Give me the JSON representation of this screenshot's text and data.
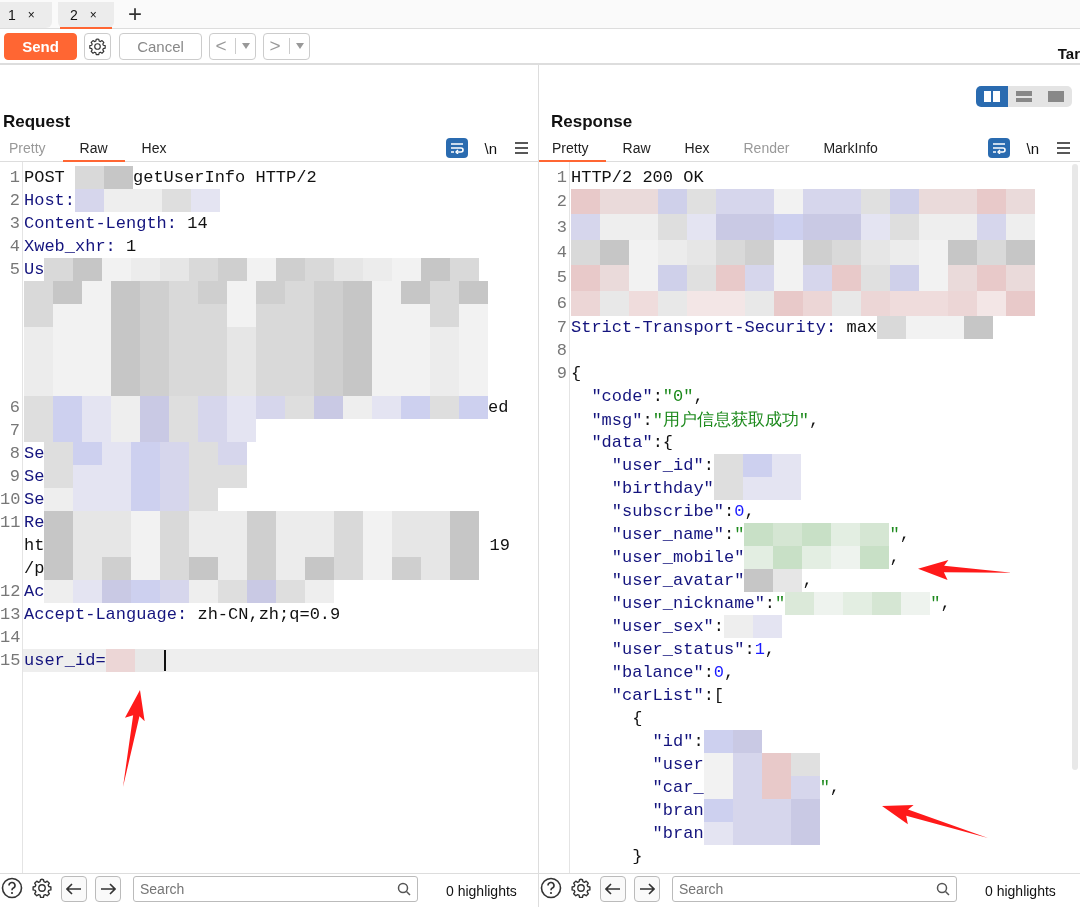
{
  "tabs": [
    {
      "label": "1",
      "close": "×",
      "selected": false
    },
    {
      "label": "2",
      "close": "×",
      "selected": true
    }
  ],
  "new_tab": "+",
  "toolbar": {
    "send": "Send",
    "cancel": "Cancel",
    "back": "<",
    "forward": ">",
    "cut_label": "Tar"
  },
  "view_buttons": [
    {
      "selected": true
    },
    {
      "selected": false
    },
    {
      "selected": false
    }
  ],
  "request": {
    "title": "Request",
    "newline": "\\n",
    "tabs": [
      {
        "label": "Pretty",
        "selected": false,
        "disabled": true
      },
      {
        "label": "Raw",
        "selected": true,
        "disabled": false
      },
      {
        "label": "Hex",
        "selected": false,
        "disabled": false
      }
    ],
    "lines": [
      {
        "number": "1",
        "current": false,
        "parts": [
          {
            "kind": "plain",
            "text": "POST "
          },
          {
            "kind": "mask"
          },
          {
            "kind": "plain",
            "text": "getUserInfo HTTP/2"
          }
        ]
      },
      {
        "number": "2",
        "current": false,
        "parts": [
          {
            "kind": "key",
            "text": "Host:"
          },
          {
            "kind": "mask"
          }
        ]
      },
      {
        "number": "3",
        "current": false,
        "parts": [
          {
            "kind": "key",
            "text": "Content-Length:"
          },
          {
            "kind": "plain",
            "text": " 14"
          }
        ]
      },
      {
        "number": "4",
        "current": false,
        "parts": [
          {
            "kind": "key",
            "text": "Xweb_xhr:"
          },
          {
            "kind": "plain",
            "text": " 1"
          }
        ]
      },
      {
        "number": "5",
        "current": false,
        "parts": [
          {
            "kind": "key",
            "text": "Us"
          },
          {
            "kind": "mask"
          }
        ]
      },
      {
        "current": false,
        "parts": [
          {
            "kind": "mask"
          }
        ]
      },
      {
        "current": false,
        "parts": [
          {
            "kind": "mask"
          }
        ]
      },
      {
        "current": false,
        "parts": [
          {
            "kind": "mask"
          }
        ]
      },
      {
        "current": false,
        "parts": [
          {
            "kind": "mask"
          }
        ]
      },
      {
        "current": false,
        "parts": [
          {
            "kind": "mask"
          }
        ]
      },
      {
        "number": "6",
        "current": false,
        "parts": [
          {
            "kind": "mask"
          },
          {
            "kind": "plain",
            "text": "ed"
          }
        ]
      },
      {
        "number": "7",
        "current": false,
        "parts": [
          {
            "kind": "mask"
          }
        ]
      },
      {
        "number": "8",
        "current": false,
        "parts": [
          {
            "kind": "key",
            "text": "Se"
          },
          {
            "kind": "mask"
          }
        ]
      },
      {
        "number": "9",
        "current": false,
        "parts": [
          {
            "kind": "key",
            "text": "Se"
          },
          {
            "kind": "mask"
          }
        ]
      },
      {
        "number": "10",
        "current": false,
        "parts": [
          {
            "kind": "key",
            "text": "Se"
          },
          {
            "kind": "mask"
          }
        ]
      },
      {
        "number": "11",
        "current": false,
        "parts": [
          {
            "kind": "key",
            "text": "Re"
          },
          {
            "kind": "mask"
          }
        ]
      },
      {
        "current": false,
        "parts": [
          {
            "kind": "plain",
            "text": "ht"
          },
          {
            "kind": "mask"
          },
          {
            "kind": "plain",
            "text": " 19"
          }
        ]
      },
      {
        "current": false,
        "parts": [
          {
            "kind": "plain",
            "text": "/p"
          },
          {
            "kind": "mask"
          }
        ]
      },
      {
        "number": "12",
        "current": false,
        "parts": [
          {
            "kind": "key",
            "text": "Ac"
          },
          {
            "kind": "mask"
          }
        ]
      },
      {
        "number": "13",
        "current": false,
        "parts": [
          {
            "kind": "key",
            "text": "Accept-Language:"
          },
          {
            "kind": "plain",
            "text": " zh-CN,zh;q=0.9"
          }
        ]
      },
      {
        "number": "14",
        "current": false
      },
      {
        "number": "15",
        "current": true,
        "parts": [
          {
            "kind": "key",
            "text": "user_id="
          },
          {
            "kind": "mask"
          }
        ]
      }
    ],
    "search": {
      "placeholder": "Search"
    },
    "highlights": "0 highlights"
  },
  "response": {
    "title": "Response",
    "newline": "\\n",
    "tabs": [
      {
        "label": "Pretty",
        "selected": true,
        "disabled": false
      },
      {
        "label": "Raw",
        "selected": false,
        "disabled": false
      },
      {
        "label": "Hex",
        "selected": false,
        "disabled": false
      },
      {
        "label": "Render",
        "selected": false,
        "disabled": true
      },
      {
        "label": "MarkInfo",
        "selected": false,
        "disabled": false
      }
    ],
    "lines": [
      {
        "number": "1",
        "current": false,
        "parts": [
          {
            "kind": "plain",
            "text": "HTTP/2 200 OK"
          }
        ]
      },
      {
        "number": "2",
        "current": false,
        "parts": [
          {
            "kind": "mask"
          }
        ]
      },
      {
        "number": "3",
        "current": false,
        "parts": [
          {
            "kind": "mask"
          }
        ]
      },
      {
        "number": "4",
        "current": false,
        "parts": [
          {
            "kind": "mask"
          }
        ]
      },
      {
        "number": "5",
        "current": false,
        "parts": [
          {
            "kind": "mask"
          }
        ]
      },
      {
        "number": "6",
        "current": false,
        "parts": [
          {
            "kind": "mask"
          }
        ]
      },
      {
        "number": "7",
        "current": false,
        "parts": [
          {
            "kind": "key",
            "text": "Strict-Transport-Security:"
          },
          {
            "kind": "plain",
            "text": " max"
          },
          {
            "kind": "mask"
          }
        ]
      },
      {
        "number": "8",
        "current": false
      },
      {
        "number": "9",
        "current": false,
        "parts": [
          {
            "kind": "plain",
            "text": "{"
          }
        ]
      },
      {
        "current": false,
        "parts": [
          {
            "kind": "key",
            "text": "  \"code\""
          },
          {
            "kind": "plain",
            "text": ":"
          },
          {
            "kind": "str",
            "text": "\"0\""
          },
          {
            "kind": "plain",
            "text": ","
          }
        ]
      },
      {
        "current": false,
        "parts": [
          {
            "kind": "key",
            "text": "  \"msg\""
          },
          {
            "kind": "plain",
            "text": ":"
          },
          {
            "kind": "str",
            "text": "\"用户信息获取成功\""
          },
          {
            "kind": "plain",
            "text": ","
          }
        ]
      },
      {
        "current": false,
        "parts": [
          {
            "kind": "key",
            "text": "  \"data\""
          },
          {
            "kind": "plain",
            "text": ":{"
          }
        ]
      },
      {
        "current": false,
        "parts": [
          {
            "kind": "key",
            "text": "    \"user_id\""
          },
          {
            "kind": "plain",
            "text": ":"
          },
          {
            "kind": "mask"
          }
        ]
      },
      {
        "current": false,
        "parts": [
          {
            "kind": "key",
            "text": "    \"birthday\""
          },
          {
            "kind": "mask"
          }
        ]
      },
      {
        "current": false,
        "parts": [
          {
            "kind": "key",
            "text": "    \"subscribe\""
          },
          {
            "kind": "plain",
            "text": ":"
          },
          {
            "kind": "num",
            "text": "0"
          },
          {
            "kind": "plain",
            "text": ","
          }
        ]
      },
      {
        "current": false,
        "parts": [
          {
            "kind": "key",
            "text": "    \"user_name\""
          },
          {
            "kind": "plain",
            "text": ":"
          },
          {
            "kind": "str",
            "text": "\""
          },
          {
            "kind": "mask"
          },
          {
            "kind": "str",
            "text": "\""
          },
          {
            "kind": "plain",
            "text": ","
          }
        ]
      },
      {
        "current": false,
        "parts": [
          {
            "kind": "key",
            "text": "    \"user_mobile\""
          },
          {
            "kind": "mask"
          },
          {
            "kind": "plain",
            "text": ","
          }
        ]
      },
      {
        "current": false,
        "parts": [
          {
            "kind": "key",
            "text": "    \"user_avatar\""
          },
          {
            "kind": "mask"
          },
          {
            "kind": "plain",
            "text": ","
          }
        ]
      },
      {
        "current": false,
        "parts": [
          {
            "kind": "key",
            "text": "    \"user_nickname\""
          },
          {
            "kind": "plain",
            "text": ":"
          },
          {
            "kind": "str",
            "text": "\""
          },
          {
            "kind": "mask"
          },
          {
            "kind": "str",
            "text": "\""
          },
          {
            "kind": "plain",
            "text": ","
          }
        ]
      },
      {
        "current": false,
        "parts": [
          {
            "kind": "key",
            "text": "    \"user_sex\""
          },
          {
            "kind": "plain",
            "text": ":"
          },
          {
            "kind": "mask"
          }
        ]
      },
      {
        "current": false,
        "parts": [
          {
            "kind": "key",
            "text": "    \"user_status\""
          },
          {
            "kind": "plain",
            "text": ":"
          },
          {
            "kind": "num",
            "text": "1"
          },
          {
            "kind": "plain",
            "text": ","
          }
        ]
      },
      {
        "current": false,
        "parts": [
          {
            "kind": "key",
            "text": "    \"balance\""
          },
          {
            "kind": "plain",
            "text": ":"
          },
          {
            "kind": "num",
            "text": "0"
          },
          {
            "kind": "plain",
            "text": ","
          }
        ]
      },
      {
        "current": false,
        "parts": [
          {
            "kind": "key",
            "text": "    \"carList\""
          },
          {
            "kind": "plain",
            "text": ":["
          }
        ]
      },
      {
        "current": false,
        "parts": [
          {
            "kind": "plain",
            "text": "      {"
          }
        ]
      },
      {
        "current": false,
        "parts": [
          {
            "kind": "key",
            "text": "        \"id\""
          },
          {
            "kind": "plain",
            "text": ":"
          },
          {
            "kind": "mask"
          }
        ]
      },
      {
        "current": false,
        "parts": [
          {
            "kind": "key",
            "text": "        \"user"
          },
          {
            "kind": "mask"
          }
        ]
      },
      {
        "current": false,
        "parts": [
          {
            "kind": "key",
            "text": "        \"car_"
          },
          {
            "kind": "mask"
          },
          {
            "kind": "str",
            "text": "\""
          },
          {
            "kind": "plain",
            "text": ","
          }
        ]
      },
      {
        "current": false,
        "parts": [
          {
            "kind": "key",
            "text": "        \"bran"
          },
          {
            "kind": "mask"
          }
        ]
      },
      {
        "current": false,
        "parts": [
          {
            "kind": "key",
            "text": "        \"bran"
          },
          {
            "kind": "mask"
          }
        ]
      },
      {
        "current": false,
        "parts": [
          {
            "kind": "plain",
            "text": "      }"
          }
        ]
      }
    ],
    "search": {
      "placeholder": "Search"
    },
    "highlights": "0 highlights"
  }
}
